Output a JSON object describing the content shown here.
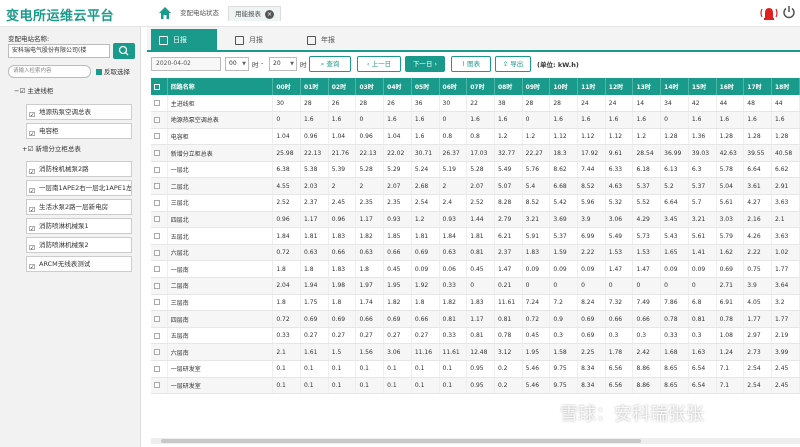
{
  "app": {
    "title": "变电所运维云平台",
    "brand_color": "#1a9a8a"
  },
  "nav": {
    "tabs": [
      {
        "label": "变配电站状态"
      },
      {
        "label": "用能报表"
      }
    ]
  },
  "sidebar": {
    "station_label": "变配电站名称:",
    "station_value": "安科瑞电气股份有限公司(楼",
    "loop_placeholder": "请输入检索内容",
    "check_all": "反取选择",
    "tree": {
      "root": "主进线柜",
      "items": [
        "地源热泵空调总表",
        "电容柜"
      ],
      "group": "新增分立柜总表",
      "group_items": [
        "消防栓机械泵2路",
        "一层南1APE2右一层北1APE1左",
        "生活水泵2路一层新电房",
        "消防喷淋机械泵1",
        "消防喷淋机械泵2",
        "ARCM无线表测试"
      ]
    }
  },
  "tabs": {
    "day": "日报",
    "month": "月报",
    "year": "年报"
  },
  "toolbar": {
    "date": "2020-04-02",
    "hour_from": "00",
    "hour_unit": "时",
    "dash": "-",
    "hour_to": "20",
    "query": "查询",
    "prev": "上一日",
    "next": "下一日",
    "chart": "图表",
    "export": "导出",
    "unit": "(单位: kW.h)"
  },
  "table": {
    "headers": [
      "回路名称",
      "00时",
      "01时",
      "02时",
      "03时",
      "04时",
      "05时",
      "06时",
      "07时",
      "08时",
      "09时",
      "10时",
      "11时",
      "12时",
      "13时",
      "14时",
      "15时",
      "16时",
      "17时",
      "18时"
    ],
    "rows": [
      [
        "主进线柜",
        "30",
        "28",
        "26",
        "28",
        "26",
        "36",
        "30",
        "22",
        "38",
        "28",
        "28",
        "24",
        "24",
        "14",
        "34",
        "42",
        "44",
        "48",
        "44"
      ],
      [
        "地源热泵空调总表",
        "0",
        "1.6",
        "1.6",
        "0",
        "1.6",
        "1.6",
        "0",
        "1.6",
        "1.6",
        "0",
        "1.6",
        "1.6",
        "1.6",
        "1.6",
        "0",
        "1.6",
        "1.6",
        "1.6",
        "1.6"
      ],
      [
        "电容柜",
        "1.04",
        "0.96",
        "1.04",
        "0.96",
        "1.04",
        "1.6",
        "0.8",
        "0.8",
        "1.2",
        "1.2",
        "1.12",
        "1.12",
        "1.12",
        "1.2",
        "1.28",
        "1.36",
        "1.28",
        "1.28",
        "1.28"
      ],
      [
        "新增分立柜总表",
        "25.98",
        "22.13",
        "21.76",
        "22.13",
        "22.02",
        "30.71",
        "26.37",
        "17.03",
        "32.77",
        "22.27",
        "18.3",
        "17.92",
        "9.61",
        "28.54",
        "36.99",
        "39.03",
        "42.63",
        "39.55",
        "40.58"
      ],
      [
        "一层北",
        "6.38",
        "5.38",
        "5.39",
        "5.28",
        "5.29",
        "5.24",
        "5.19",
        "5.28",
        "5.49",
        "5.76",
        "8.62",
        "7.44",
        "6.33",
        "6.18",
        "6.13",
        "6.3",
        "5.78",
        "6.64",
        "6.62"
      ],
      [
        "二层北",
        "4.55",
        "2.03",
        "2",
        "2",
        "2.07",
        "2.68",
        "2",
        "2.07",
        "5.07",
        "5.4",
        "6.68",
        "8.52",
        "4.63",
        "5.37",
        "5.2",
        "5.37",
        "5.04",
        "3.61",
        "2.91"
      ],
      [
        "三层北",
        "2.52",
        "2.37",
        "2.45",
        "2.35",
        "2.35",
        "2.54",
        "2.4",
        "2.52",
        "8.28",
        "8.52",
        "5.42",
        "5.96",
        "5.32",
        "5.52",
        "6.64",
        "5.7",
        "5.61",
        "4.27",
        "3.63"
      ],
      [
        "四层北",
        "0.96",
        "1.17",
        "0.96",
        "1.17",
        "0.93",
        "1.2",
        "0.93",
        "1.44",
        "2.79",
        "3.21",
        "3.69",
        "3.9",
        "3.06",
        "4.29",
        "3.45",
        "3.21",
        "3.03",
        "2.16",
        "2.1"
      ],
      [
        "五层北",
        "1.84",
        "1.81",
        "1.83",
        "1.82",
        "1.85",
        "1.81",
        "1.84",
        "1.81",
        "6.21",
        "5.91",
        "5.37",
        "6.99",
        "5.49",
        "5.73",
        "5.43",
        "5.61",
        "5.79",
        "4.26",
        "3.63"
      ],
      [
        "六层北",
        "0.72",
        "0.63",
        "0.66",
        "0.63",
        "0.66",
        "0.69",
        "0.63",
        "0.81",
        "2.37",
        "1.83",
        "1.59",
        "2.22",
        "1.53",
        "1.53",
        "1.65",
        "1.41",
        "1.62",
        "2.22",
        "1.02"
      ],
      [
        "一层南",
        "1.8",
        "1.8",
        "1.83",
        "1.8",
        "0.45",
        "0.09",
        "0.06",
        "0.45",
        "1.47",
        "0.09",
        "0.09",
        "0.09",
        "1.47",
        "1.47",
        "0.09",
        "0.09",
        "0.69",
        "0.75",
        "1.77"
      ],
      [
        "二层南",
        "2.04",
        "1.94",
        "1.98",
        "1.97",
        "1.95",
        "1.92",
        "0.33",
        "0",
        "0.21",
        "0",
        "0",
        "0",
        "0",
        "0",
        "0",
        "0",
        "2.71",
        "3.9",
        "3.64"
      ],
      [
        "三层南",
        "1.8",
        "1.75",
        "1.8",
        "1.74",
        "1.82",
        "1.8",
        "1.82",
        "1.83",
        "11.61",
        "7.24",
        "7.2",
        "8.24",
        "7.32",
        "7.49",
        "7.86",
        "6.8",
        "6.91",
        "4.05",
        "3.2"
      ],
      [
        "四层南",
        "0.72",
        "0.69",
        "0.69",
        "0.66",
        "0.69",
        "0.66",
        "0.81",
        "1.17",
        "0.81",
        "0.72",
        "0.9",
        "0.69",
        "0.66",
        "0.66",
        "0.78",
        "0.81",
        "0.78",
        "1.77",
        "1.77"
      ],
      [
        "五层南",
        "0.33",
        "0.27",
        "0.27",
        "0.27",
        "0.27",
        "0.27",
        "0.33",
        "0.81",
        "0.78",
        "0.45",
        "0.3",
        "0.69",
        "0.3",
        "0.3",
        "0.33",
        "0.3",
        "1.08",
        "2.97",
        "2.19"
      ],
      [
        "六层南",
        "2.1",
        "1.61",
        "1.5",
        "1.56",
        "3.06",
        "11.16",
        "11.61",
        "12.48",
        "3.12",
        "1.95",
        "1.58",
        "2.25",
        "1.78",
        "2.42",
        "1.68",
        "1.63",
        "1.24",
        "2.73",
        "3.99"
      ],
      [
        "一层研发室",
        "0.1",
        "0.1",
        "0.1",
        "0.1",
        "0.1",
        "0.1",
        "0.1",
        "0.95",
        "0.2",
        "5.46",
        "9.75",
        "8.34",
        "6.56",
        "8.86",
        "8.65",
        "6.54",
        "7.1",
        "2.54",
        "2.45"
      ],
      [
        "一层研发室",
        "0.1",
        "0.1",
        "0.1",
        "0.1",
        "0.1",
        "0.1",
        "0.1",
        "0.95",
        "0.2",
        "5.46",
        "9.75",
        "8.34",
        "6.56",
        "8.86",
        "8.65",
        "6.54",
        "7.1",
        "2.54",
        "2.45"
      ]
    ]
  },
  "watermark": "雪球：安科瑞张张"
}
